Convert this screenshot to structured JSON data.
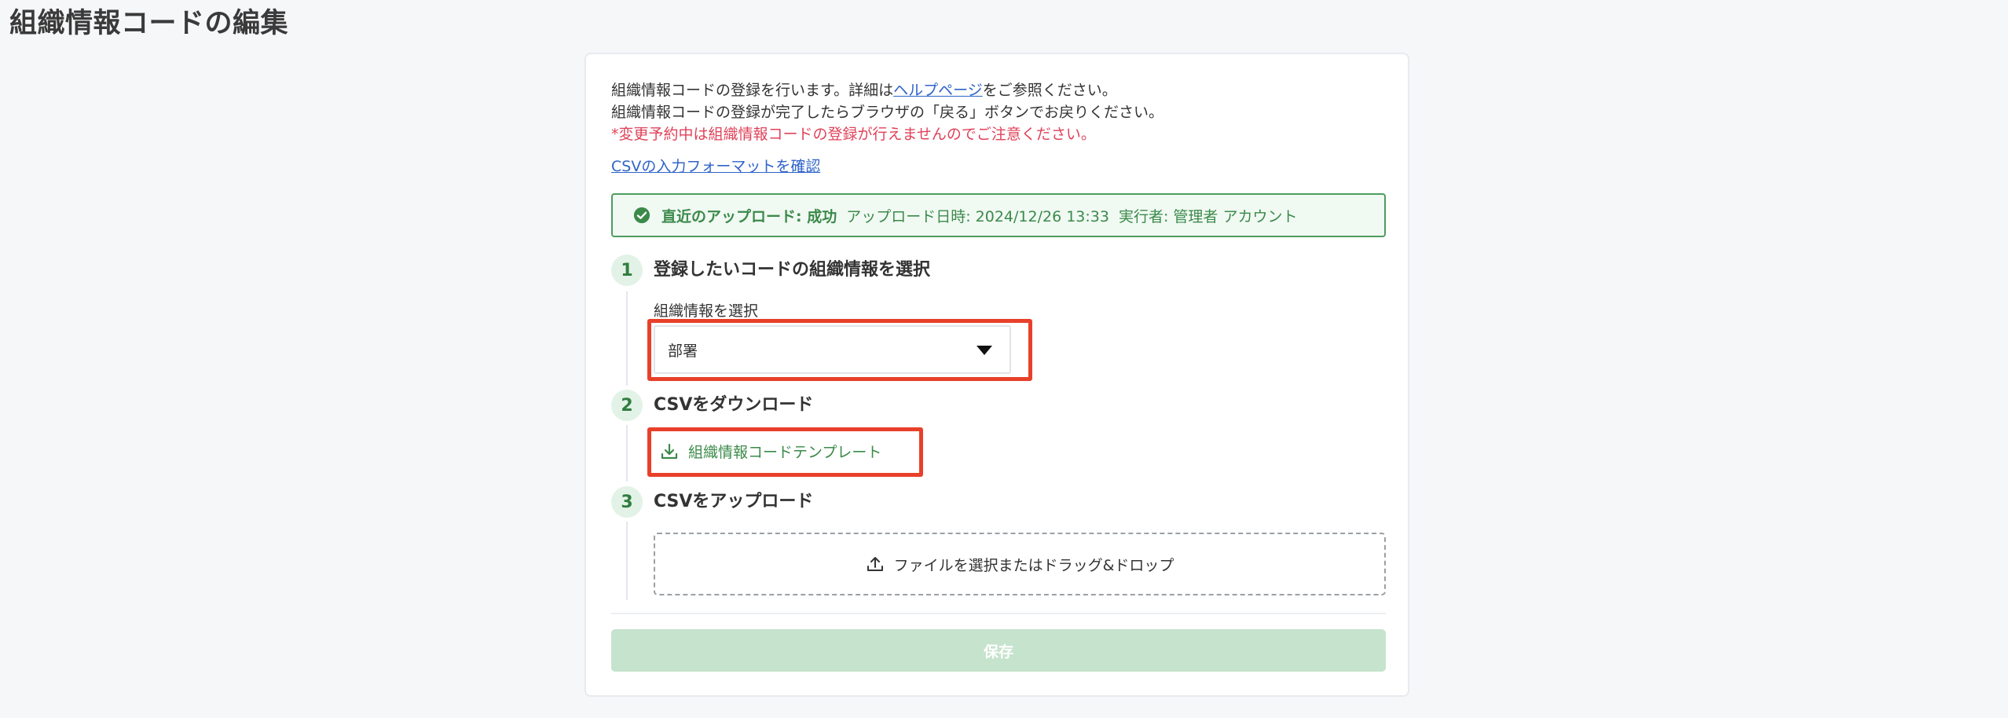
{
  "page": {
    "title": "組織情報コードの編集"
  },
  "intro": {
    "line1_before": "組織情報コードの登録を行います。詳細は",
    "line1_link": "ヘルプページ",
    "line1_after": "をご参照ください。",
    "line2": "組織情報コードの登録が完了したらブラウザの「戻る」ボタンでお戻りください。",
    "warning": "*変更予約中は組織情報コードの登録が行えませんのでご注意ください。",
    "csv_format_link": "CSVの入力フォーマットを確認"
  },
  "status": {
    "label": "直近のアップロード: 成功",
    "datetime": "アップロード日時: 2024/12/26 13:33",
    "executor": "実行者: 管理者 アカウント",
    "color": "#3b8a4a"
  },
  "steps": [
    {
      "number": "1",
      "title": "登録したいコードの組織情報を選択",
      "field_label": "組織情報を選択",
      "select_value": "部署"
    },
    {
      "number": "2",
      "title": "CSVをダウンロード",
      "download_label": "組織情報コードテンプレート"
    },
    {
      "number": "3",
      "title": "CSVをアップロード",
      "dropzone_label": "ファイルを選択またはドラッグ&ドロップ"
    }
  ],
  "actions": {
    "save_label": "保存"
  },
  "icons": {
    "status": "check-circle-icon",
    "select": "caret-down-icon",
    "download": "download-icon",
    "upload": "upload-icon"
  },
  "colors": {
    "accent_green": "#3b8a4a",
    "highlight_red": "#e8402a",
    "warning_red": "#e0425a",
    "link_blue": "#2f63c9"
  }
}
